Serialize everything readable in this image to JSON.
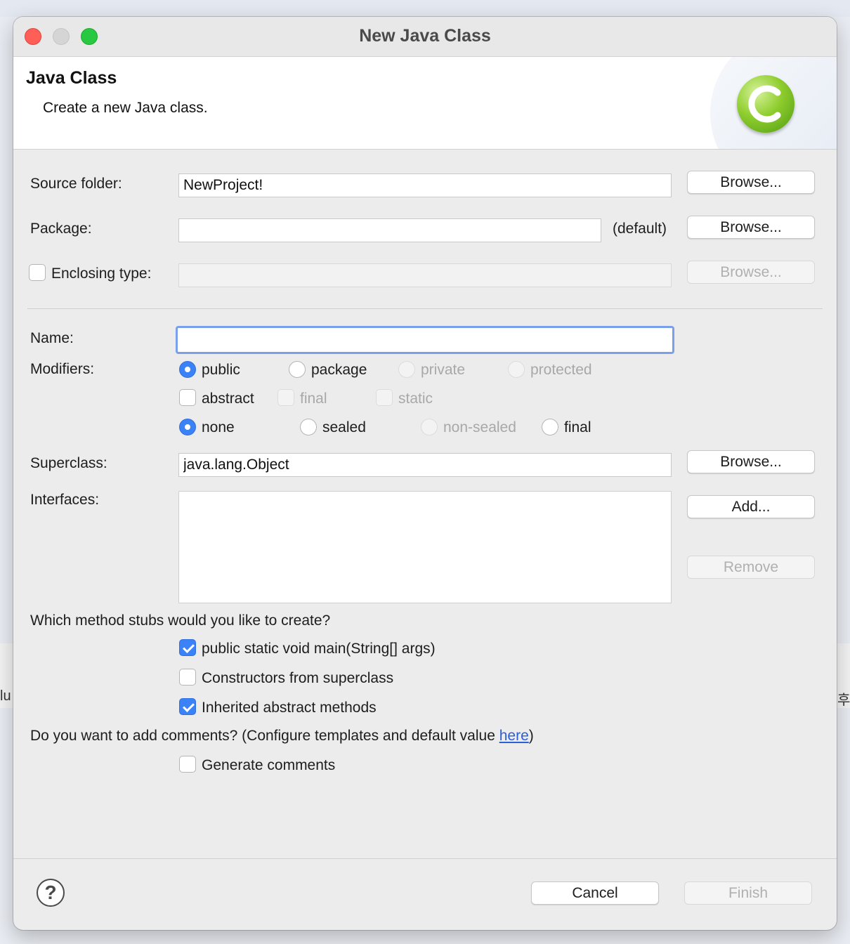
{
  "window": {
    "title": "New Java Class"
  },
  "banner": {
    "title": "Java Class",
    "subtitle": "Create a new Java class.",
    "icon": "java-class-c-icon"
  },
  "source_folder": {
    "label": "Source folder:",
    "value": "NewProject!",
    "browse": "Browse..."
  },
  "package": {
    "label": "Package:",
    "value": "",
    "default_hint": "(default)",
    "browse": "Browse..."
  },
  "enclosing": {
    "label": "Enclosing type:",
    "checked": false,
    "value": "",
    "browse": "Browse..."
  },
  "name": {
    "label": "Name:",
    "value": ""
  },
  "modifiers": {
    "label": "Modifiers:",
    "access": {
      "public": "public",
      "package": "package",
      "private": "private",
      "protected": "protected",
      "selected": "public"
    },
    "flags": {
      "abstract": "abstract",
      "final": "final",
      "static": "static"
    },
    "sealing": {
      "none": "none",
      "sealed": "sealed",
      "non_sealed": "non-sealed",
      "final": "final",
      "selected": "none"
    }
  },
  "superclass": {
    "label": "Superclass:",
    "value": "java.lang.Object",
    "browse": "Browse..."
  },
  "interfaces": {
    "label": "Interfaces:",
    "add": "Add...",
    "remove": "Remove"
  },
  "stubs": {
    "question": "Which method stubs would you like to create?",
    "main": "public static void main(String[] args)",
    "constructors": "Constructors from superclass",
    "inherited": "Inherited abstract methods"
  },
  "comments": {
    "question_prefix": "Do you want to add comments? (Configure templates and default value ",
    "link": "here",
    "question_suffix": ")",
    "generate": "Generate comments"
  },
  "footer": {
    "cancel": "Cancel",
    "finish": "Finish"
  },
  "background": {
    "left_fragment": "lu",
    "right_fragment": "후"
  }
}
